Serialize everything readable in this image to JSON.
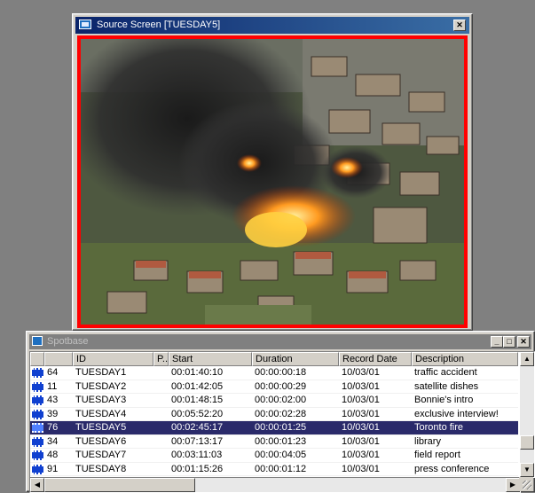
{
  "source_window": {
    "title": "Source Screen [TUESDAY5]",
    "close_glyph": "✕"
  },
  "spotbase": {
    "title": "Spotbase",
    "window_controls": {
      "minimize": "_",
      "maximize": "□",
      "close": "✕"
    },
    "columns": [
      "",
      "ID",
      "P..",
      "Start",
      "Duration",
      "Record Date",
      "Description"
    ],
    "rows": [
      {
        "num": "64",
        "id": "TUESDAY1",
        "p": "",
        "start": "00:01:40:10",
        "duration": "00:00:00:18",
        "date": "10/03/01",
        "desc": "traffic accident"
      },
      {
        "num": "11",
        "id": "TUESDAY2",
        "p": "",
        "start": "00:01:42:05",
        "duration": "00:00:00:29",
        "date": "10/03/01",
        "desc": "satellite dishes"
      },
      {
        "num": "43",
        "id": "TUESDAY3",
        "p": "",
        "start": "00:01:48:15",
        "duration": "00:00:02:00",
        "date": "10/03/01",
        "desc": "Bonnie's intro"
      },
      {
        "num": "39",
        "id": "TUESDAY4",
        "p": "",
        "start": "00:05:52:20",
        "duration": "00:00:02:28",
        "date": "10/03/01",
        "desc": "exclusive interview!"
      },
      {
        "num": "76",
        "id": "TUESDAY5",
        "p": "",
        "start": "00:02:45:17",
        "duration": "00:00:01:25",
        "date": "10/03/01",
        "desc": "Toronto fire"
      },
      {
        "num": "34",
        "id": "TUESDAY6",
        "p": "",
        "start": "00:07:13:17",
        "duration": "00:00:01:23",
        "date": "10/03/01",
        "desc": "library"
      },
      {
        "num": "48",
        "id": "TUESDAY7",
        "p": "",
        "start": "00:03:11:03",
        "duration": "00:00:04:05",
        "date": "10/03/01",
        "desc": "field report"
      },
      {
        "num": "91",
        "id": "TUESDAY8",
        "p": "",
        "start": "00:01:15:26",
        "duration": "00:00:01:12",
        "date": "10/03/01",
        "desc": "press conference"
      }
    ],
    "selected_id": "TUESDAY5",
    "scroll_glyphs": {
      "up": "▲",
      "down": "▼",
      "left": "◀",
      "right": "▶"
    }
  },
  "colors": {
    "frame_border": "#ff0000",
    "selected_row": "#2a2a6a",
    "active_titlebar": "#0a246a"
  },
  "icons": {
    "row_icon": "film-clip-icon",
    "window_icon": "monitor-icon"
  }
}
